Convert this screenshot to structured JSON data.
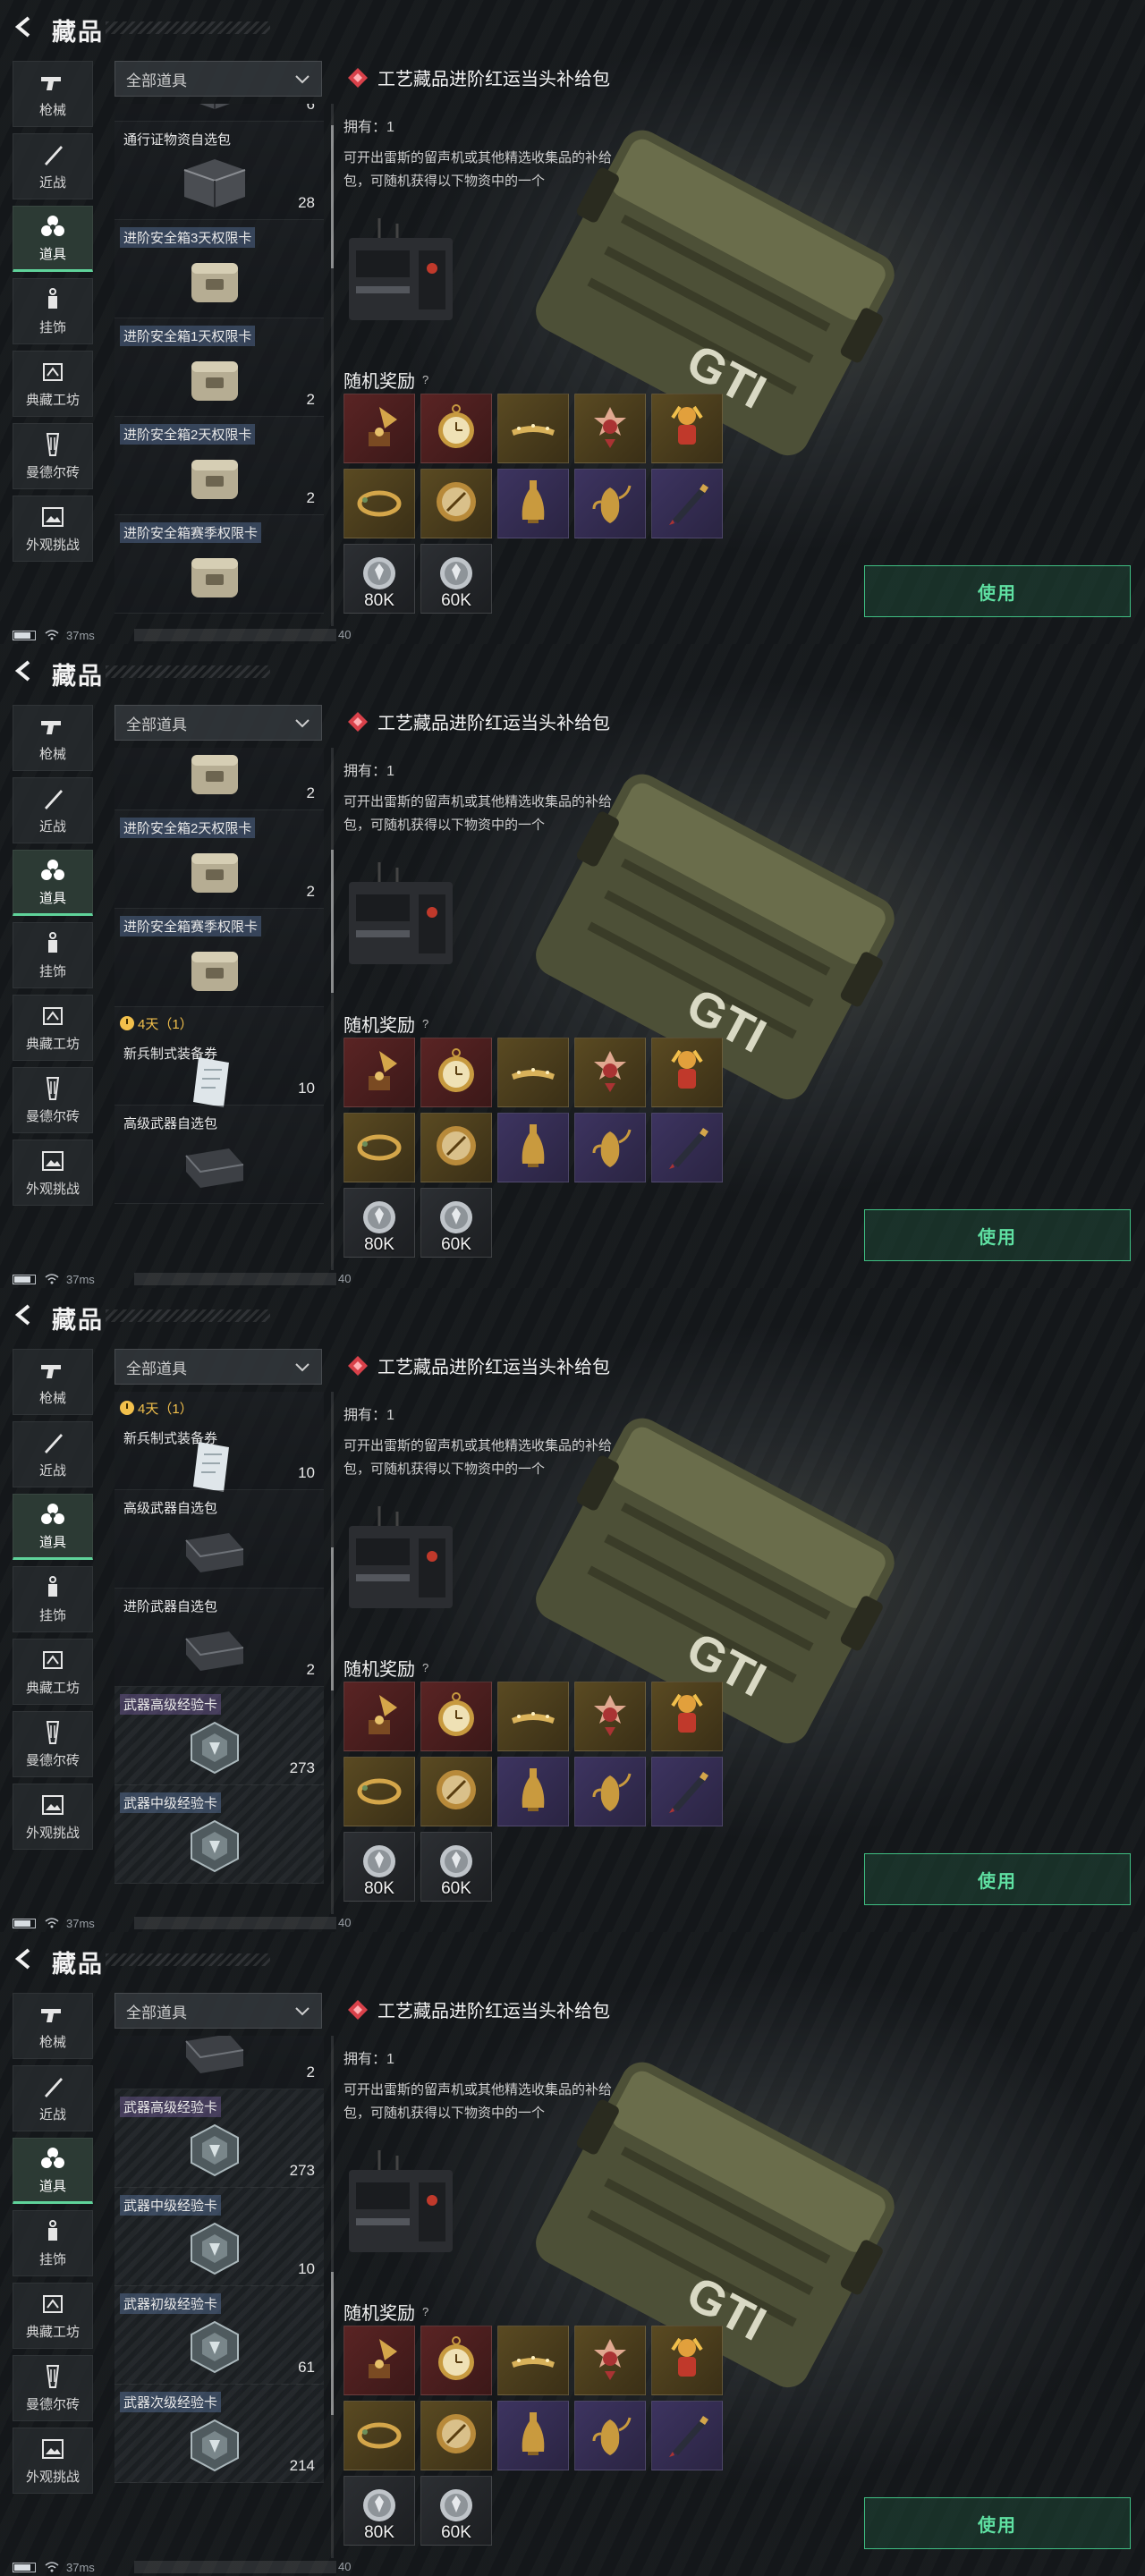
{
  "header": {
    "title": "藏品"
  },
  "nav": [
    {
      "id": "guns",
      "label": "枪械",
      "icon": "gun-icon"
    },
    {
      "id": "melee",
      "label": "近战",
      "icon": "knife-icon"
    },
    {
      "id": "items",
      "label": "道具",
      "icon": "biohazard-icon",
      "active": true
    },
    {
      "id": "charms",
      "label": "挂饰",
      "icon": "charm-icon"
    },
    {
      "id": "workshop",
      "label": "典藏工坊",
      "icon": "workshop-icon"
    },
    {
      "id": "bricks",
      "label": "曼德尔砖",
      "icon": "brick-icon"
    },
    {
      "id": "skins",
      "label": "外观挑战",
      "icon": "image-icon"
    }
  ],
  "filter": {
    "label": "全部道具"
  },
  "detail": {
    "title": "工艺藏品进阶红运当头补给包",
    "owned": "拥有：1",
    "desc": "可开出雷斯的留声机或其他精选收集品的补给包，可随机获得以下物资中的一个",
    "reward_title": "随机奖励",
    "reward_help": "?",
    "use_label": "使用",
    "accent": "#5fe0a2"
  },
  "rewards": [
    {
      "icon": "gramophone-icon",
      "tint": "red"
    },
    {
      "icon": "pocket-watch-icon",
      "tint": "red"
    },
    {
      "icon": "crown-icon",
      "tint": "gold"
    },
    {
      "icon": "medal-icon",
      "tint": "gold"
    },
    {
      "icon": "figurine-icon",
      "tint": "gold"
    },
    {
      "icon": "bracelet-icon",
      "tint": "gold"
    },
    {
      "icon": "compass-icon",
      "tint": "gold"
    },
    {
      "icon": "vase-icon",
      "tint": "purple"
    },
    {
      "icon": "teapot-icon",
      "tint": "purple"
    },
    {
      "icon": "pen-icon",
      "tint": "purple"
    },
    {
      "icon": "coin-icon",
      "tint": "dark",
      "value": "80K"
    },
    {
      "icon": "coin-icon",
      "tint": "dark",
      "value": "60K"
    }
  ],
  "status": {
    "ping": "37ms",
    "net": "40"
  },
  "frames": [
    {
      "items": [
        {
          "name": "",
          "count": "6",
          "icon": "crate-icon",
          "partial": "top"
        },
        {
          "name": "通行证物资自选包",
          "count": "28",
          "icon": "crate-icon"
        },
        {
          "name": "进阶安全箱3天权限卡",
          "count": "",
          "icon": "safebox-icon",
          "tag": "tag"
        },
        {
          "name": "进阶安全箱1天权限卡",
          "count": "2",
          "icon": "safebox-icon",
          "tag": "tag"
        },
        {
          "name": "进阶安全箱2天权限卡",
          "count": "2",
          "icon": "safebox-icon",
          "tag": "tag"
        },
        {
          "name": "进阶安全箱赛季权限卡",
          "count": "",
          "icon": "safebox-icon",
          "tag": "tag"
        }
      ]
    },
    {
      "items": [
        {
          "name": "",
          "count": "2",
          "icon": "safebox-icon",
          "partial": "top"
        },
        {
          "name": "进阶安全箱2天权限卡",
          "count": "2",
          "icon": "safebox-icon",
          "tag": "tag"
        },
        {
          "name": "进阶安全箱赛季权限卡",
          "count": "",
          "icon": "safebox-icon",
          "tag": "tag"
        },
        {
          "timer": "4天（1）",
          "name": "新兵制式装备券",
          "count": "10",
          "icon": "ticket-icon"
        },
        {
          "name": "高级武器自选包",
          "count": "",
          "icon": "weapon-case-icon"
        }
      ]
    },
    {
      "items": [
        {
          "timer": "4天（1）",
          "name": "新兵制式装备券",
          "count": "10",
          "icon": "ticket-icon"
        },
        {
          "name": "高级武器自选包",
          "count": "",
          "icon": "weapon-case-icon"
        },
        {
          "name": "进阶武器自选包",
          "count": "2",
          "icon": "weapon-case-icon"
        },
        {
          "name": "武器高级经验卡",
          "count": "273",
          "icon": "exp-card-icon",
          "tag": "tag-gold",
          "exp": true
        },
        {
          "name": "武器中级经验卡",
          "count": "",
          "icon": "exp-card-icon",
          "tag": "tag",
          "exp": true
        }
      ]
    },
    {
      "items": [
        {
          "name": "",
          "count": "2",
          "icon": "weapon-case-icon",
          "partial": "top"
        },
        {
          "name": "武器高级经验卡",
          "count": "273",
          "icon": "exp-card-icon",
          "tag": "tag-gold",
          "exp": true
        },
        {
          "name": "武器中级经验卡",
          "count": "10",
          "icon": "exp-card-icon",
          "tag": "tag",
          "exp": true
        },
        {
          "name": "武器初级经验卡",
          "count": "61",
          "icon": "exp-card-icon",
          "tag": "tag",
          "exp": true
        },
        {
          "name": "武器次级经验卡",
          "count": "214",
          "icon": "exp-card-icon",
          "tag": "tag",
          "exp": true
        }
      ]
    }
  ]
}
